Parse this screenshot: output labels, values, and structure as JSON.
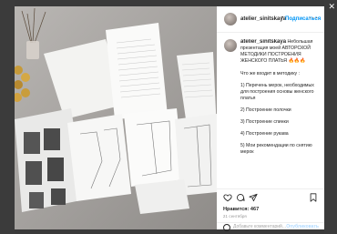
{
  "post": {
    "username": "atelier_sinitskaya",
    "follow_label": "Подписаться",
    "caption_intro": "Небольшая презентация моей АВТОРСКОЙ МЕТОДИКИ ПОСТРОЕНИЯ ЖЕНСКОГО ПЛАТЬЯ 🔥🔥🔥",
    "caption_lines": [
      "Что же входит в методику :",
      "1) Перечень мерок, необходимых для построения основы женского платья",
      "2) Построение полочки",
      "3) Построение спинки",
      "4) Построение рукава",
      "5) Мои рекомендации по снятию мерок"
    ],
    "likes": "Нравится: 467",
    "date": "21 сентября",
    "comment_placeholder": "Добавьте комментарий...",
    "publish_label": "Опубликовать"
  },
  "icons": {
    "heart": "heart-icon",
    "comment": "comment-icon",
    "share": "share-icon",
    "bookmark": "bookmark-icon",
    "more": "more-options-icon",
    "emoji": "emoji-icon",
    "close": "close-icon"
  },
  "colors": {
    "link_blue": "#0095f6",
    "publish_disabled": "#b3dbff",
    "backdrop": "#3a3a3a"
  }
}
